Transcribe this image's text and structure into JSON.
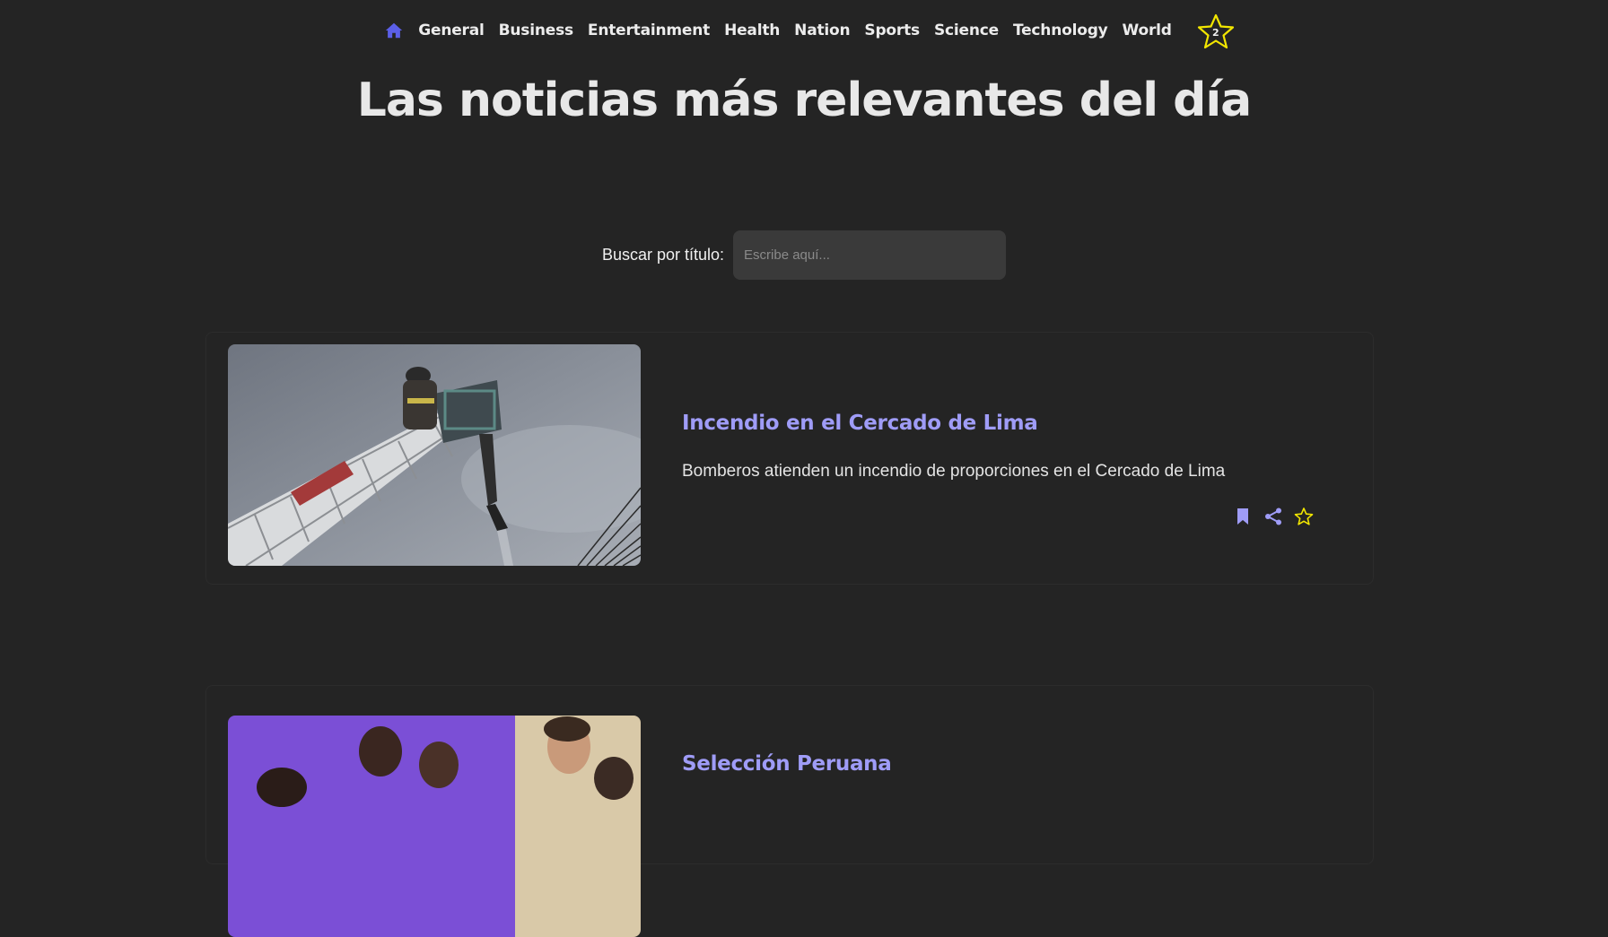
{
  "nav": {
    "home_icon": "home-icon",
    "links": [
      "General",
      "Business",
      "Entertainment",
      "Health",
      "Nation",
      "Sports",
      "Science",
      "Technology",
      "World"
    ],
    "favorites_count": "2",
    "favorites_icon": "star-icon"
  },
  "hero": {
    "title": "Las noticias más relevantes del día"
  },
  "search": {
    "label": "Buscar por título:",
    "placeholder": "Escribe aquí...",
    "value": ""
  },
  "articles": [
    {
      "title": "Incendio en el Cercado de Lima",
      "description": "Bomberos atienden un incendio de proporciones en el Cercado de Lima",
      "actions": [
        "bookmark-icon",
        "share-icon",
        "star-icon"
      ]
    },
    {
      "title": "Selección Peruana"
    }
  ],
  "colors": {
    "background": "#242424",
    "accent": "#9f9cf7",
    "home": "#5b5fe8",
    "star": "#f2e600"
  }
}
